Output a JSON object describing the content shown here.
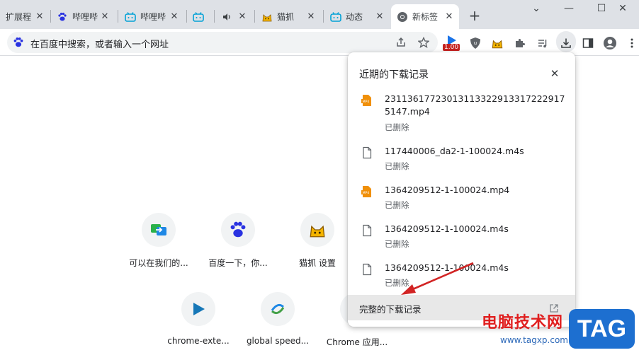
{
  "tabs": [
    {
      "title": "扩展程",
      "icon": "none-icon"
    },
    {
      "title": "哔哩哔",
      "icon": "baidu-paw-icon"
    },
    {
      "title": "哔哩哔",
      "icon": "bilibili-icon"
    },
    {
      "title": "",
      "icon": "bilibili-icon"
    },
    {
      "title": "",
      "icon": "speaker-icon"
    },
    {
      "title": "猫抓",
      "icon": "cat-icon"
    },
    {
      "title": "动态",
      "icon": "bilibili-icon"
    },
    {
      "title": "新标签",
      "icon": "chrome-icon"
    }
  ],
  "window": {
    "minimize": "—",
    "maximize": "☐",
    "close": "✕",
    "new_tab": "+"
  },
  "toolbar": {
    "omnibox_placeholder": "在百度中搜索，或者输入一个网址",
    "extension_badge": "1.00"
  },
  "shortcuts": [
    {
      "label": "可以在我们的...",
      "icon": "transfer-icon"
    },
    {
      "label": "百度一下，你...",
      "icon": "baidu-paw-icon"
    },
    {
      "label": "猫抓 设置",
      "icon": "cat-icon"
    },
    {
      "label": "chrome-exte...",
      "icon": "play-icon"
    },
    {
      "label": "global speed...",
      "icon": "global-speed-icon"
    },
    {
      "label": "Chrome 应用...",
      "icon": "chrome-apps-icon"
    }
  ],
  "downloads": {
    "title": "近期的下载记录",
    "items": [
      {
        "name": "231136177230131133229133172229175147.mp4",
        "status": "已删除",
        "type": "mp4"
      },
      {
        "name": "117440006_da2-1-100024.m4s",
        "status": "已删除",
        "type": "file"
      },
      {
        "name": "1364209512-1-100024.mp4",
        "status": "已删除",
        "type": "mp4"
      },
      {
        "name": "1364209512-1-100024.m4s",
        "status": "已删除",
        "type": "file"
      },
      {
        "name": "1364209512-1-100024.m4s",
        "status": "已删除",
        "type": "file"
      }
    ],
    "full_history": "完整的下载记录"
  },
  "watermark": {
    "text": "电脑技术网",
    "url": "www.tagxp.com",
    "tag": "TAG"
  },
  "colors": {
    "tabstrip": "#dee1e6",
    "accent_red": "#e01f1f",
    "tag_blue": "#1d6fd0",
    "mp4_orange": "#f0900a"
  }
}
